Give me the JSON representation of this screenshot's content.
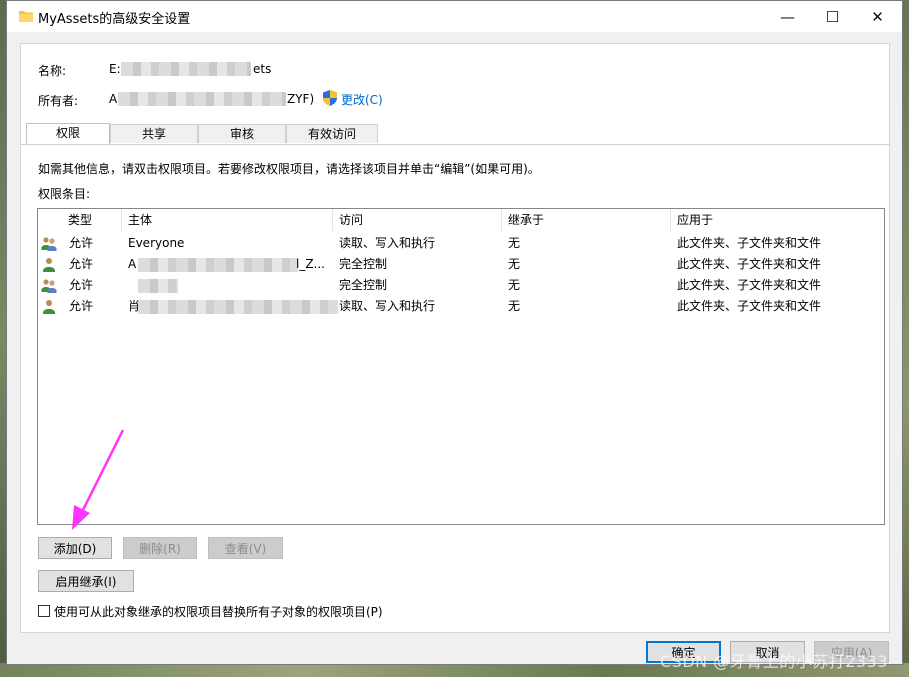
{
  "window": {
    "title": "MyAssets的高级安全设置",
    "controls": {
      "minimize": "—",
      "maximize": "☐",
      "close": "✕"
    }
  },
  "header": {
    "name_label": "名称:",
    "name_value_start": "E:",
    "name_value_end": "ets",
    "owner_label": "所有者:",
    "owner_value_start": "A",
    "owner_value_end": "ZYF)",
    "change_link": "更改(C)"
  },
  "tabs": [
    {
      "label": "权限",
      "active": true
    },
    {
      "label": "共享",
      "active": false
    },
    {
      "label": "审核",
      "active": false
    },
    {
      "label": "有效访问",
      "active": false
    }
  ],
  "info_text": "如需其他信息，请双击权限项目。若要修改权限项目，请选择该项目并单击“编辑”(如果可用)。",
  "entries_label": "权限条目:",
  "columns": [
    "类型",
    "主体",
    "访问",
    "继承于",
    "应用于"
  ],
  "rows": [
    {
      "icon": "group-icon",
      "type": "允许",
      "principal": "Everyone",
      "access": "读取、写入和执行",
      "inherited": "无",
      "applies": "此文件夹、子文件夹和文件"
    },
    {
      "icon": "user-icon",
      "type": "允许",
      "principal": "A",
      "principal_tail": "l_Z...",
      "access": "完全控制",
      "inherited": "无",
      "applies": "此文件夹、子文件夹和文件"
    },
    {
      "icon": "group-icon",
      "type": "允许",
      "principal": "",
      "access": "完全控制",
      "inherited": "无",
      "applies": "此文件夹、子文件夹和文件"
    },
    {
      "icon": "user-icon",
      "type": "允许",
      "principal": "肖",
      "access": "读取、写入和执行",
      "inherited": "无",
      "applies": "此文件夹、子文件夹和文件"
    }
  ],
  "buttons": {
    "add": "添加(D)",
    "delete": "删除(R)",
    "view": "查看(V)",
    "enable_inheritance": "启用继承(I)",
    "ok": "确定",
    "cancel": "取消",
    "apply": "应用(A)"
  },
  "checkbox": {
    "label": "使用可从此对象继承的权限项目替换所有子对象的权限项目(P)",
    "checked": false
  },
  "watermark": "CSDN @牙膏上的小苏打2333",
  "annotation_color": "#ff33ff"
}
